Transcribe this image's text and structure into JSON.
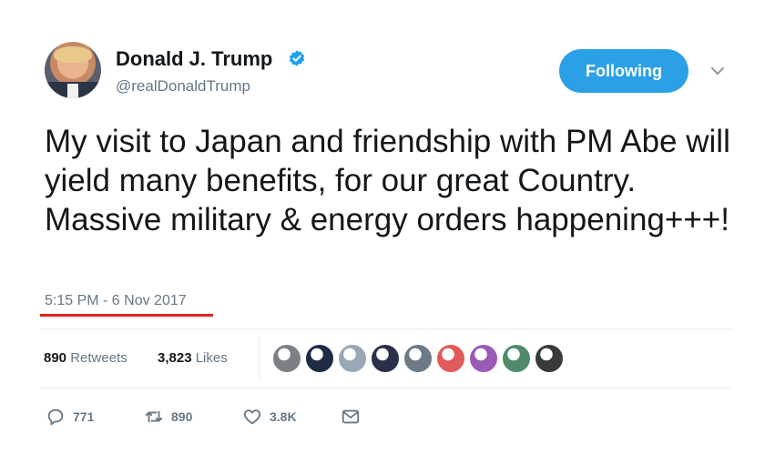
{
  "author": {
    "name": "Donald J. Trump",
    "handle": "@realDonaldTrump",
    "verified": true
  },
  "follow_button": {
    "label": "Following"
  },
  "tweet": {
    "text": "My visit to Japan and friendship with PM Abe will yield many benefits, for our great Country. Massive military & energy orders happening+++!",
    "timestamp": "5:15 PM - 6 Nov 2017"
  },
  "stats": {
    "retweets": {
      "count": "890",
      "label": "Retweets"
    },
    "likes": {
      "count": "3,823",
      "label": "Likes"
    }
  },
  "likers": [
    {
      "color": "#7b7f86"
    },
    {
      "color": "#1f2a44"
    },
    {
      "color": "#9aa8b6"
    },
    {
      "color": "#2a2f4a"
    },
    {
      "color": "#6c7a86"
    },
    {
      "color": "#e35a5a"
    },
    {
      "color": "#9b5ab5"
    },
    {
      "color": "#4f8a6a"
    },
    {
      "color": "#3a3a3a"
    }
  ],
  "actions": {
    "reply": {
      "icon": "reply-icon",
      "count": "771"
    },
    "retweet": {
      "icon": "retweet-icon",
      "count": "890"
    },
    "like": {
      "icon": "heart-icon",
      "count": "3.8K"
    },
    "dm": {
      "icon": "envelope-icon"
    }
  },
  "colors": {
    "accent": "#2ba0e6",
    "muted": "#657786",
    "highlight_underline": "#e0231f"
  }
}
